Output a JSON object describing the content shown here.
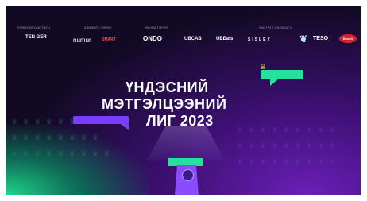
{
  "sponsors": {
    "labels": [
      "ЕРӨНХИЙ ХАМТРАГЧ",
      "ДЭМЖИГЧ ТӨРӨЛ",
      "ӨМНӨД ТӨРӨЛ",
      "ХАМТРАН АЖИЛЛАГЧ"
    ],
    "logos": [
      "TEN GER",
      "numur",
      "SMART",
      "ONDO",
      "UBCAB",
      "UBEats",
      "SISLEY",
      "TESO",
      "Bosch"
    ]
  },
  "title": {
    "line1": "ҮНДЭСНИЙ",
    "line2": "МЭТГЭЛЦЭЭНИЙ",
    "line3": "ЛИГ 2023"
  },
  "colors": {
    "accent_green": "#27e0a0",
    "accent_purple": "#7a3cff",
    "crown_gold": "#d6b32a",
    "background": "#120a24"
  }
}
